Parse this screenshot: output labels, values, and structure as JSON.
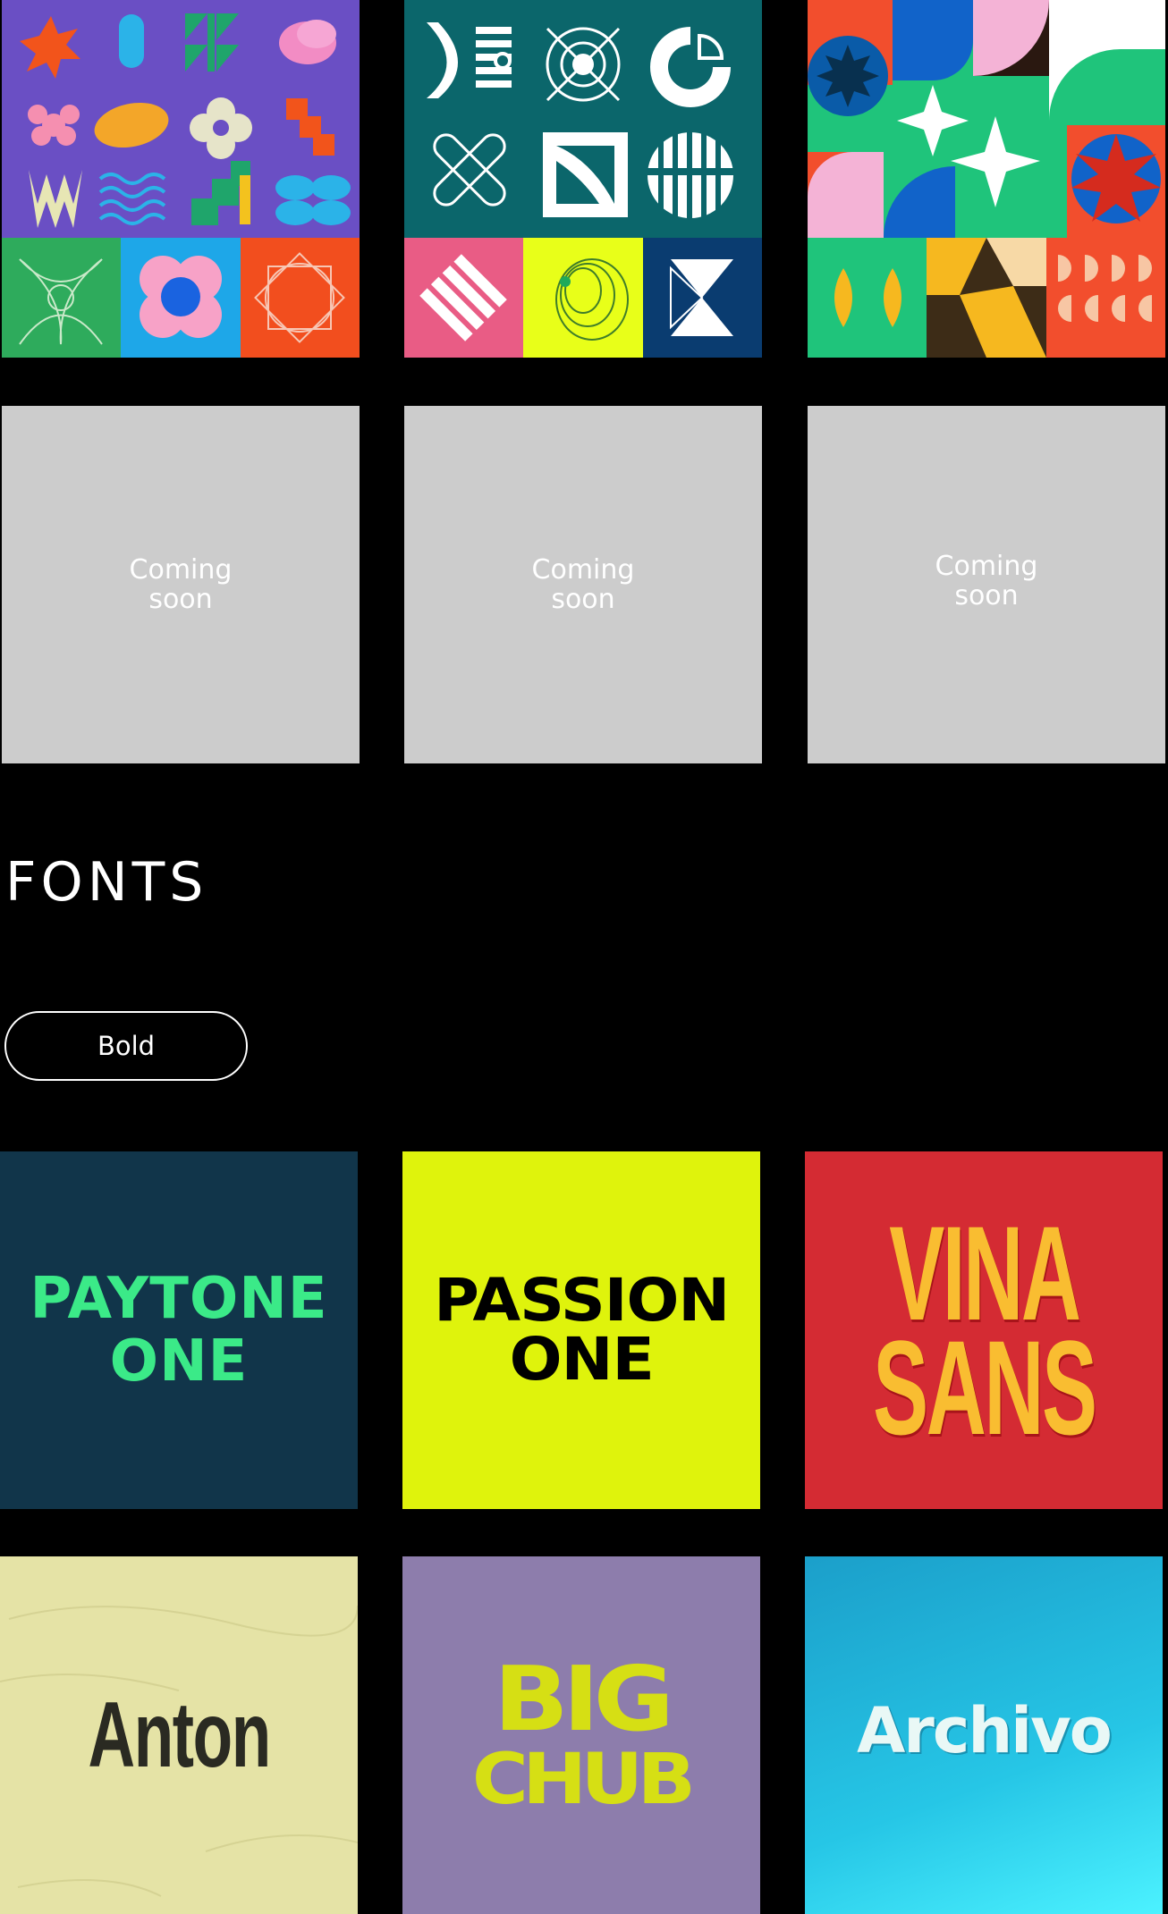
{
  "coming_soon": {
    "card1": "Coming soon",
    "card2": "Coming soon",
    "card3": "Coming soon"
  },
  "fonts_section": {
    "heading": "FONTS",
    "filter_label": "Bold"
  },
  "font_cards": [
    {
      "lines": [
        "PAYTONE",
        "ONE"
      ]
    },
    {
      "lines": [
        "PASSION",
        "ONE"
      ]
    },
    {
      "lines": [
        "VINA",
        "SANS"
      ]
    },
    {
      "lines": [
        "Anton"
      ]
    },
    {
      "lines": [
        "BIG",
        "CHUB"
      ]
    },
    {
      "lines": [
        "Archivo"
      ]
    }
  ],
  "colors": {
    "background": "#000000",
    "placeholder": "#cccccc"
  }
}
